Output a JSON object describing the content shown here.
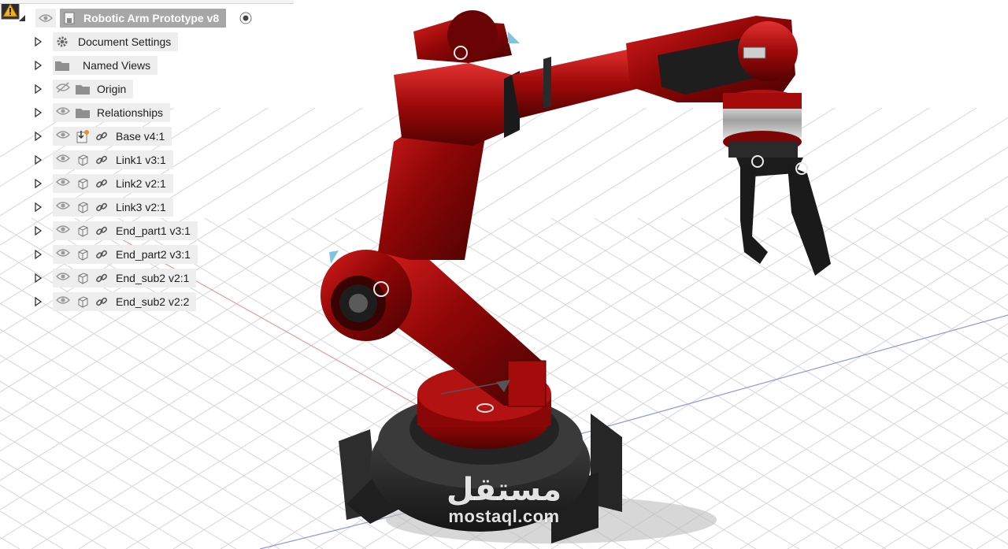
{
  "browser": {
    "root": {
      "label": "Robotic Arm Prototype v8"
    },
    "items": [
      {
        "label": "Document Settings",
        "type": "settings",
        "eye": false,
        "link": false
      },
      {
        "label": "Named Views",
        "type": "folder",
        "eye": false,
        "link": false
      },
      {
        "label": "Origin",
        "type": "folder",
        "eye": "hidden",
        "link": false
      },
      {
        "label": "Relationships",
        "type": "folder",
        "eye": true,
        "link": false
      },
      {
        "label": "Base v4:1",
        "type": "grounded-component",
        "eye": true,
        "link": true
      },
      {
        "label": "Link1 v3:1",
        "type": "component",
        "eye": true,
        "link": true
      },
      {
        "label": "Link2 v2:1",
        "type": "component",
        "eye": true,
        "link": true
      },
      {
        "label": "Link3 v2:1",
        "type": "component",
        "eye": true,
        "link": true
      },
      {
        "label": "End_part1 v3:1",
        "type": "component",
        "eye": true,
        "link": true
      },
      {
        "label": "End_part2 v3:1",
        "type": "component",
        "eye": true,
        "link": true
      },
      {
        "label": "End_sub2 v2:1",
        "type": "component",
        "eye": true,
        "link": true
      },
      {
        "label": "End_sub2 v2:2",
        "type": "component",
        "eye": true,
        "link": true
      }
    ]
  },
  "watermark": {
    "arabic": "مستقل",
    "latin": "mostaql.com"
  },
  "colors": {
    "arm_red": "#9c0a0a",
    "arm_dark": "#2a2a2a",
    "grid": "#d8d8d8",
    "axis_red": "#e58c8c",
    "axis_blue": "#7a86e0",
    "panel_bg": "#eeeeee",
    "root_bg": "#a7a7a7"
  }
}
